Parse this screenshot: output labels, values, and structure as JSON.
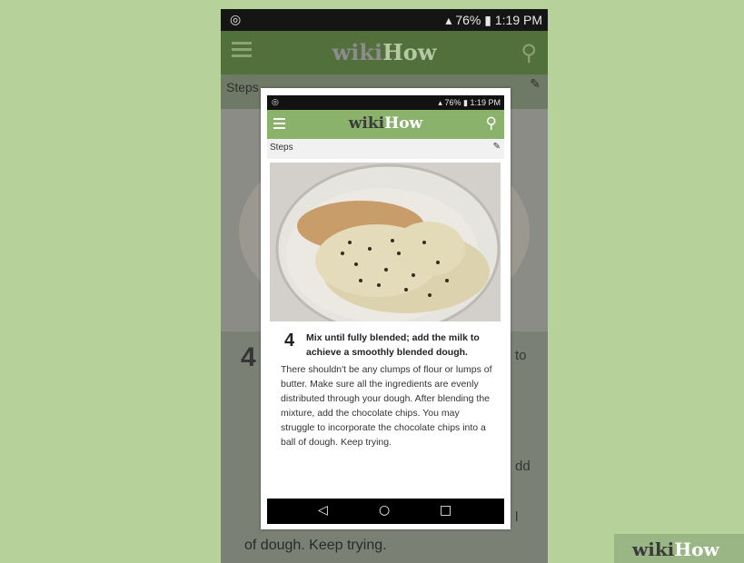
{
  "background_color": "#b7d19a",
  "accent_green": "#8ab26a",
  "back_screen": {
    "status": {
      "battery": "76%",
      "time": "1:19 PM"
    },
    "brand": {
      "wiki": "wiki",
      "how": "How"
    },
    "steps_label": "Steps",
    "step_number": "4",
    "fragment_to": "to",
    "fragment_dd": "dd",
    "fragment_l": "l",
    "body_tail": "of dough. Keep trying."
  },
  "front_screen": {
    "status": {
      "battery": "76%",
      "time": "1:19 PM"
    },
    "brand": {
      "wiki": "wiki",
      "how": "How"
    },
    "steps_label": "Steps",
    "step_number": "4",
    "step_title": "Mix until fully blended; add the milk to achieve a smoothly blended dough.",
    "step_body": "There shouldn't be any clumps of flour or lumps of butter. Make sure all the ingredients are evenly distributed through your dough. After blending the mixture, add the chocolate chips. You may struggle to incorporate the chocolate chips into a ball of dough. Keep trying.",
    "nav": {
      "back": "◁",
      "home": "○",
      "recents": "□"
    }
  },
  "watermark": {
    "wiki": "wiki",
    "how": "How"
  }
}
